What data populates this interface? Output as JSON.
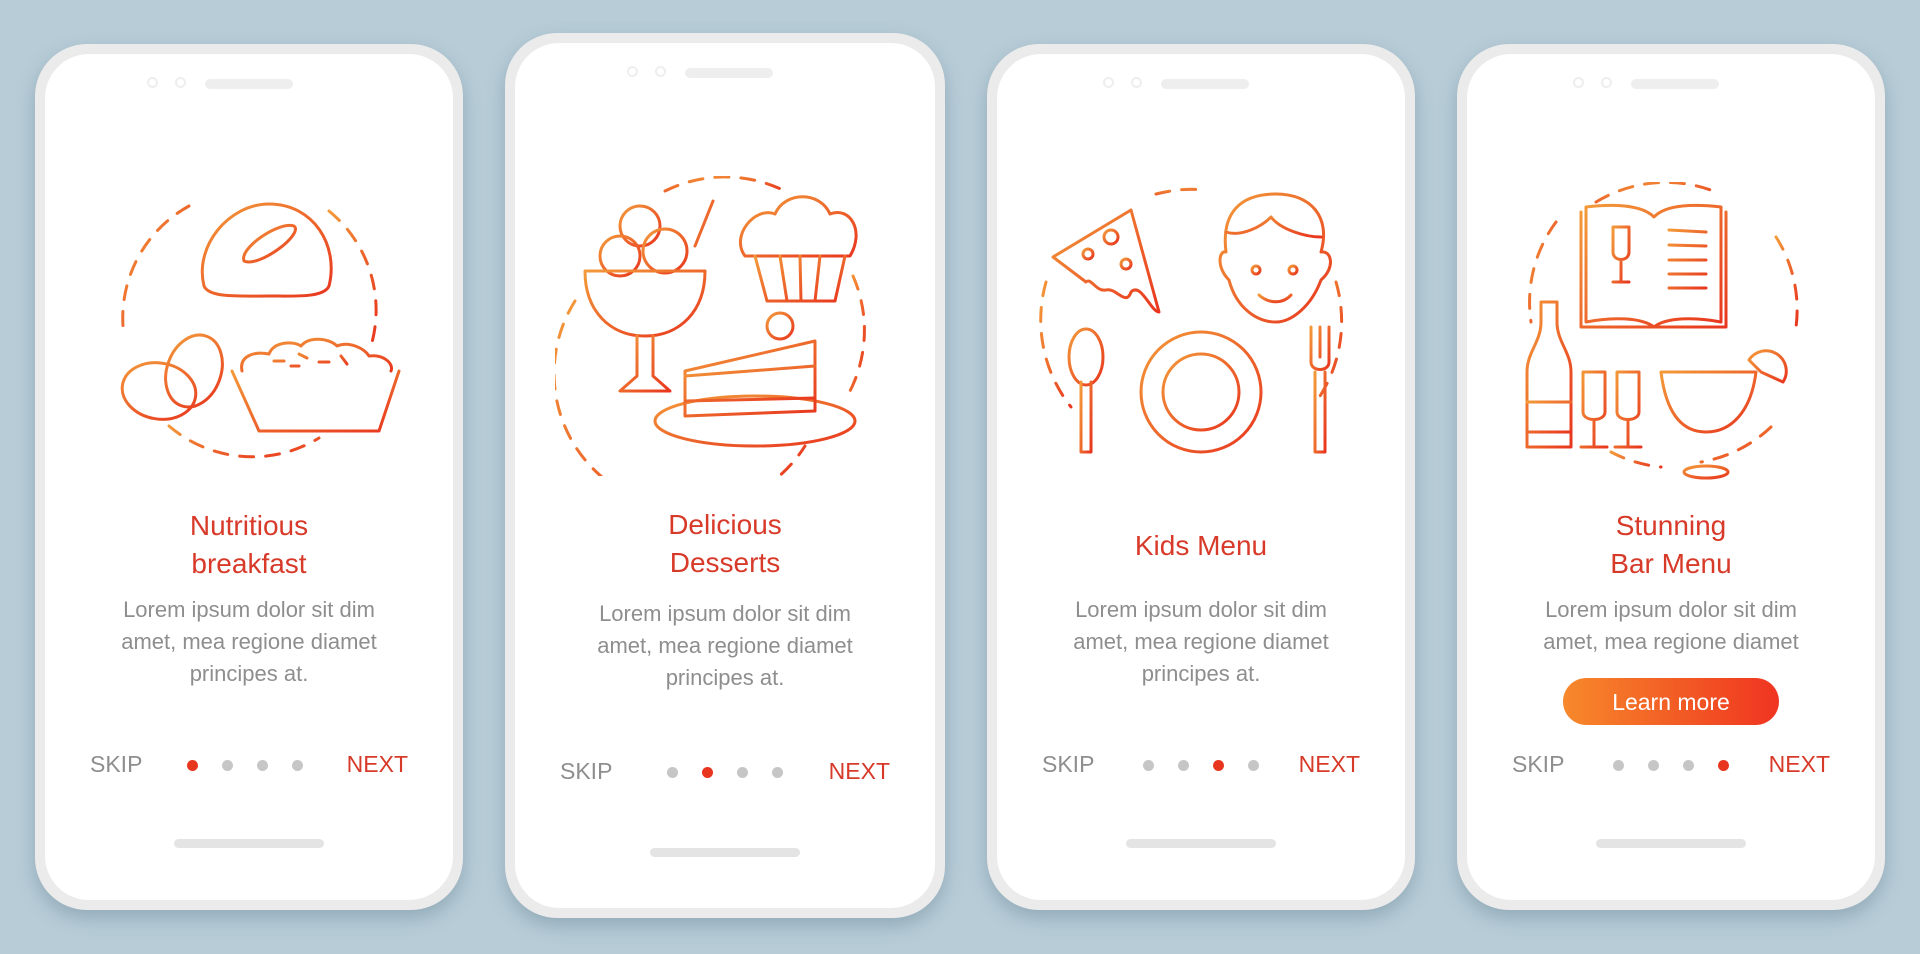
{
  "colors": {
    "background": "#b7ccd7",
    "accent": "#d83a2a",
    "active_dot": "#e8361e",
    "inactive_dot": "#c6c6c6",
    "body_text": "#8e8e8e",
    "gradient_start": "#f7892b",
    "gradient_end": "#f03421"
  },
  "screens": [
    {
      "illustration": "breakfast-icon",
      "title": "Nutritious\nbreakfast",
      "body": "Lorem ipsum dolor sit dim\namet, mea regione diamet\nprincipes at.",
      "skip_label": "SKIP",
      "next_label": "NEXT",
      "active_page": 1,
      "page_count": 4
    },
    {
      "illustration": "desserts-icon",
      "title": "Delicious\nDesserts",
      "body": "Lorem ipsum dolor sit dim\namet, mea regione diamet\nprincipes at.",
      "skip_label": "SKIP",
      "next_label": "NEXT",
      "active_page": 2,
      "page_count": 4
    },
    {
      "illustration": "kids-menu-icon",
      "title": "Kids Menu",
      "body": "Lorem ipsum dolor sit dim\namet, mea regione diamet\nprincipes at.",
      "skip_label": "SKIP",
      "next_label": "NEXT",
      "active_page": 3,
      "page_count": 4
    },
    {
      "illustration": "bar-menu-icon",
      "title": "Stunning\nBar Menu",
      "body": "Lorem ipsum dolor sit dim\namet, mea regione diamet",
      "cta_label": "Learn more",
      "skip_label": "SKIP",
      "next_label": "NEXT",
      "active_page": 4,
      "page_count": 4
    }
  ]
}
